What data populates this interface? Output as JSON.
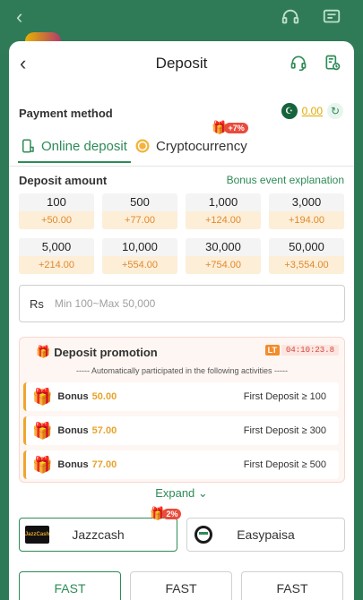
{
  "header": {
    "title": "Deposit"
  },
  "payment": {
    "label": "Payment method",
    "balance": "0.00"
  },
  "tabs": {
    "online": "Online deposit",
    "crypto": "Cryptocurrency",
    "crypto_badge": "+7%"
  },
  "amount": {
    "label": "Deposit amount",
    "bonus_link": "Bonus event explanation",
    "options": [
      {
        "value": "100",
        "bonus": "+50.00"
      },
      {
        "value": "500",
        "bonus": "+77.00"
      },
      {
        "value": "1,000",
        "bonus": "+124.00"
      },
      {
        "value": "3,000",
        "bonus": "+194.00"
      },
      {
        "value": "5,000",
        "bonus": "+214.00"
      },
      {
        "value": "10,000",
        "bonus": "+554.00"
      },
      {
        "value": "30,000",
        "bonus": "+754.00"
      },
      {
        "value": "50,000",
        "bonus": "+3,554.00"
      }
    ],
    "currency": "Rs",
    "placeholder": "Min 100~Max 50,000"
  },
  "promotion": {
    "title": "Deposit promotion",
    "timer_badge": "LT",
    "timer": "04:10:23.8",
    "note": "----- Automatically participated in the following activities -----",
    "rows": [
      {
        "label": "Bonus",
        "value": "50.00",
        "condition": "First Deposit ≥ 100"
      },
      {
        "label": "Bonus",
        "value": "57.00",
        "condition": "First Deposit ≥ 300"
      },
      {
        "label": "Bonus",
        "value": "77.00",
        "condition": "First Deposit ≥ 500"
      }
    ],
    "expand": "Expand"
  },
  "channels": {
    "items": [
      {
        "name": "Jazzcash",
        "logo_text": "JazzCash"
      },
      {
        "name": "Easypaisa"
      }
    ],
    "badge": "2%"
  },
  "fast": {
    "items": [
      "FAST",
      "FAST",
      "FAST"
    ]
  },
  "colors": {
    "accent": "#2e8b57",
    "bonus": "#e8a32a",
    "badge": "#e94b3c"
  }
}
